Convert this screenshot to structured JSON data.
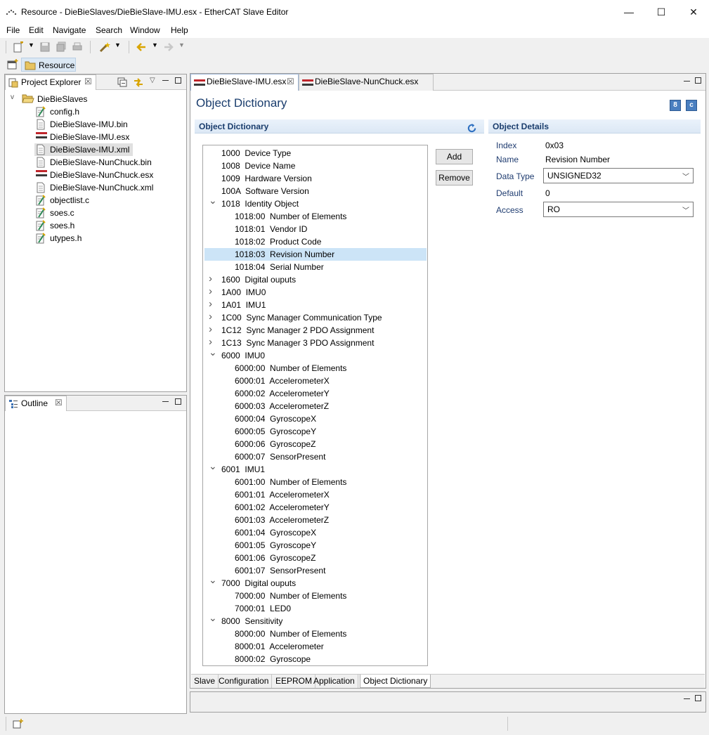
{
  "window": {
    "title": "Resource - DieBieSlaves/DieBieSlave-IMU.esx - EtherCAT Slave Editor",
    "min_glyph": "—",
    "max_glyph": "☐",
    "close_glyph": "✕"
  },
  "menu": [
    "File",
    "Edit",
    "Navigate",
    "Search",
    "Window",
    "Help"
  ],
  "perspective": {
    "label": "Resource"
  },
  "project_explorer": {
    "tab_label": "Project Explorer",
    "project": "DieBieSlaves",
    "files": [
      {
        "name": "config.h",
        "icon": "c-header-icon"
      },
      {
        "name": "DieBieSlave-IMU.bin",
        "icon": "file-icon"
      },
      {
        "name": "DieBieSlave-IMU.esx",
        "icon": "esx-icon"
      },
      {
        "name": "DieBieSlave-IMU.xml",
        "icon": "file-icon",
        "selected": true
      },
      {
        "name": "DieBieSlave-NunChuck.bin",
        "icon": "file-icon"
      },
      {
        "name": "DieBieSlave-NunChuck.esx",
        "icon": "esx-icon"
      },
      {
        "name": "DieBieSlave-NunChuck.xml",
        "icon": "file-icon"
      },
      {
        "name": "objectlist.c",
        "icon": "c-source-icon"
      },
      {
        "name": "soes.c",
        "icon": "c-source-icon"
      },
      {
        "name": "soes.h",
        "icon": "c-header-icon"
      },
      {
        "name": "utypes.h",
        "icon": "c-header-icon"
      }
    ]
  },
  "outline": {
    "tab_label": "Outline"
  },
  "editor_tabs": [
    {
      "label": "DieBieSlave-IMU.esx",
      "active": true
    },
    {
      "label": "DieBieSlave-NunChuck.esx",
      "active": false
    }
  ],
  "editor": {
    "heading": "Object Dictionary",
    "od_section": "Object Dictionary",
    "details_section": "Object Details",
    "add_label": "Add",
    "remove_label": "Remove",
    "tree": [
      {
        "level": 0,
        "twisty": "",
        "text": "1000  Device Type"
      },
      {
        "level": 0,
        "twisty": "",
        "text": "1008  Device Name"
      },
      {
        "level": 0,
        "twisty": "",
        "text": "1009  Hardware Version"
      },
      {
        "level": 0,
        "twisty": "",
        "text": "100A  Software Version"
      },
      {
        "level": 0,
        "twisty": "v",
        "text": "1018  Identity Object"
      },
      {
        "level": 1,
        "twisty": "",
        "text": "1018:00  Number of Elements"
      },
      {
        "level": 1,
        "twisty": "",
        "text": "1018:01  Vendor ID"
      },
      {
        "level": 1,
        "twisty": "",
        "text": "1018:02  Product Code"
      },
      {
        "level": 1,
        "twisty": "",
        "text": "1018:03  Revision Number",
        "selected": true
      },
      {
        "level": 1,
        "twisty": "",
        "text": "1018:04  Serial Number"
      },
      {
        "level": 0,
        "twisty": ">",
        "text": "1600  Digital ouputs"
      },
      {
        "level": 0,
        "twisty": ">",
        "text": "1A00  IMU0"
      },
      {
        "level": 0,
        "twisty": ">",
        "text": "1A01  IMU1"
      },
      {
        "level": 0,
        "twisty": ">",
        "text": "1C00  Sync Manager Communication Type"
      },
      {
        "level": 0,
        "twisty": ">",
        "text": "1C12  Sync Manager 2 PDO Assignment"
      },
      {
        "level": 0,
        "twisty": ">",
        "text": "1C13  Sync Manager 3 PDO Assignment"
      },
      {
        "level": 0,
        "twisty": "v",
        "text": "6000  IMU0"
      },
      {
        "level": 1,
        "twisty": "",
        "text": "6000:00  Number of Elements"
      },
      {
        "level": 1,
        "twisty": "",
        "text": "6000:01  AccelerometerX"
      },
      {
        "level": 1,
        "twisty": "",
        "text": "6000:02  AccelerometerY"
      },
      {
        "level": 1,
        "twisty": "",
        "text": "6000:03  AccelerometerZ"
      },
      {
        "level": 1,
        "twisty": "",
        "text": "6000:04  GyroscopeX"
      },
      {
        "level": 1,
        "twisty": "",
        "text": "6000:05  GyroscopeY"
      },
      {
        "level": 1,
        "twisty": "",
        "text": "6000:06  GyroscopeZ"
      },
      {
        "level": 1,
        "twisty": "",
        "text": "6000:07  SensorPresent"
      },
      {
        "level": 0,
        "twisty": "v",
        "text": "6001  IMU1"
      },
      {
        "level": 1,
        "twisty": "",
        "text": "6001:00  Number of Elements"
      },
      {
        "level": 1,
        "twisty": "",
        "text": "6001:01  AccelerometerX"
      },
      {
        "level": 1,
        "twisty": "",
        "text": "6001:02  AccelerometerY"
      },
      {
        "level": 1,
        "twisty": "",
        "text": "6001:03  AccelerometerZ"
      },
      {
        "level": 1,
        "twisty": "",
        "text": "6001:04  GyroscopeX"
      },
      {
        "level": 1,
        "twisty": "",
        "text": "6001:05  GyroscopeY"
      },
      {
        "level": 1,
        "twisty": "",
        "text": "6001:06  GyroscopeZ"
      },
      {
        "level": 1,
        "twisty": "",
        "text": "6001:07  SensorPresent"
      },
      {
        "level": 0,
        "twisty": "v",
        "text": "7000  Digital ouputs"
      },
      {
        "level": 1,
        "twisty": "",
        "text": "7000:00  Number of Elements"
      },
      {
        "level": 1,
        "twisty": "",
        "text": "7000:01  LED0"
      },
      {
        "level": 0,
        "twisty": "v",
        "text": "8000  Sensitivity"
      },
      {
        "level": 1,
        "twisty": "",
        "text": "8000:00  Number of Elements"
      },
      {
        "level": 1,
        "twisty": "",
        "text": "8000:01  Accelerometer"
      },
      {
        "level": 1,
        "twisty": "",
        "text": "8000:02  Gyroscope"
      }
    ],
    "details": {
      "index_label": "Index",
      "index_value": "0x03",
      "name_label": "Name",
      "name_value": "Revision Number",
      "datatype_label": "Data Type",
      "datatype_value": "UNSIGNED32",
      "default_label": "Default",
      "default_value": "0",
      "access_label": "Access",
      "access_value": "RO"
    },
    "bottom_tabs": [
      "Slave",
      "Configuration",
      "EEPROM",
      "Application",
      "Object Dictionary"
    ],
    "active_bottom_tab": "Object Dictionary"
  },
  "colors": {
    "accent": "#1a3d6d",
    "selection": "#cce4f7",
    "perspective_button": "#dbe8f4"
  }
}
